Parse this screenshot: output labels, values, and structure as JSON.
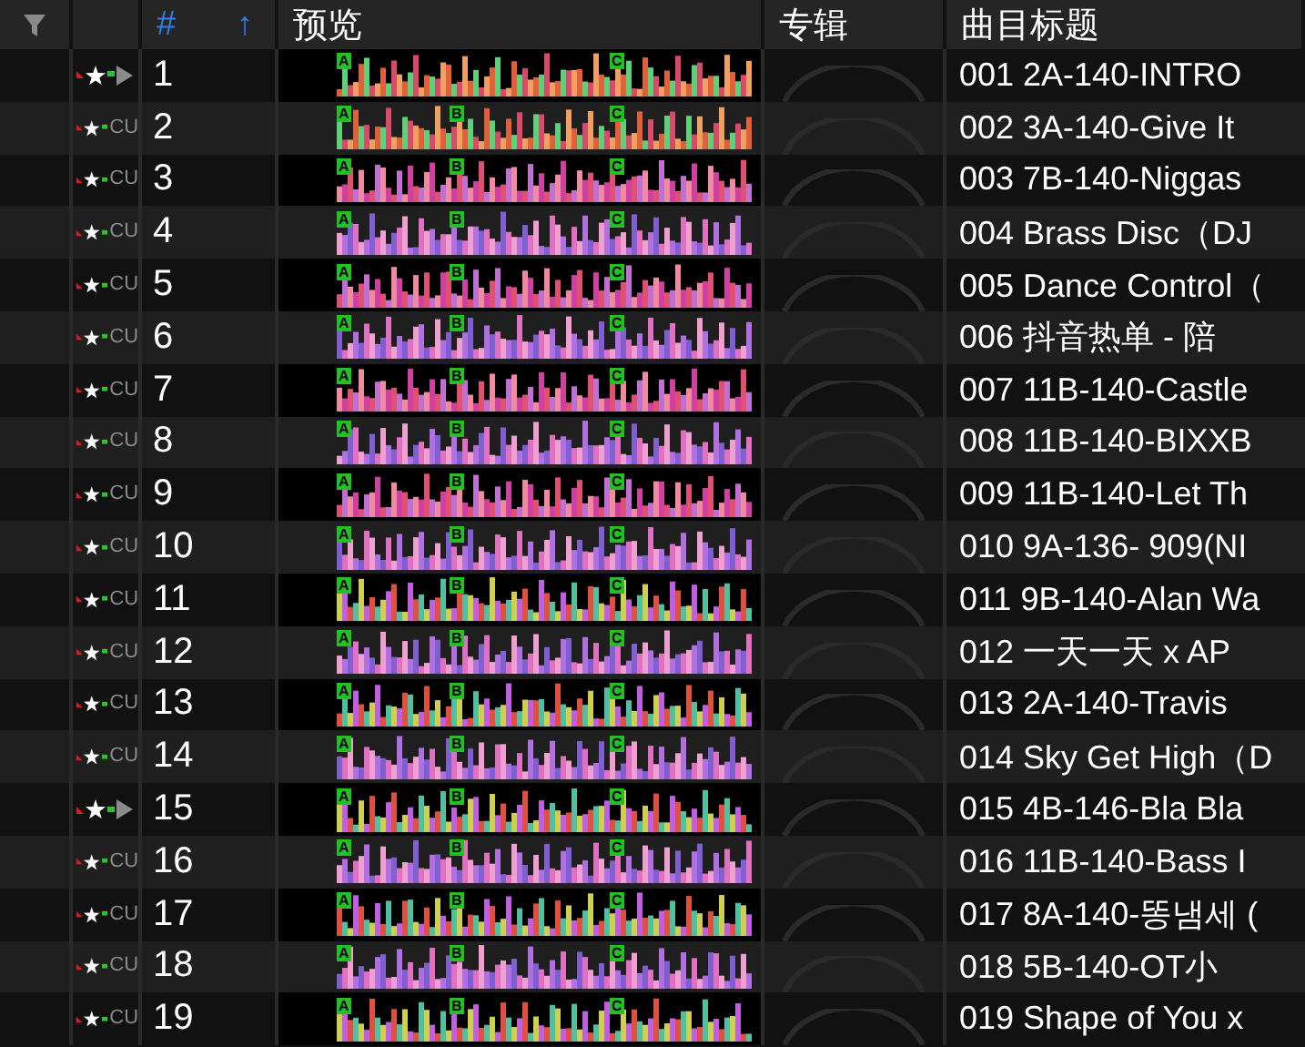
{
  "header": {
    "number": "#",
    "sort": "↑",
    "preview": "预览",
    "album": "专辑",
    "title": "曲目标题"
  },
  "rows": [
    {
      "cue": {
        "kind": "play"
      },
      "number": "1",
      "markers": [
        "A",
        "C"
      ],
      "title": "001 2A-140-INTRO"
    },
    {
      "cue": {
        "kind": "text",
        "label": "CU"
      },
      "number": "2",
      "markers": [
        "A",
        "B",
        "C"
      ],
      "title": "002 3A-140-Give It"
    },
    {
      "cue": {
        "kind": "text",
        "label": "CU"
      },
      "number": "3",
      "markers": [
        "A",
        "B",
        "C"
      ],
      "title": "003 7B-140-Niggas"
    },
    {
      "cue": {
        "kind": "text",
        "label": "CU"
      },
      "number": "4",
      "markers": [
        "A",
        "B",
        "C"
      ],
      "title": "004 Brass Disc（DJ"
    },
    {
      "cue": {
        "kind": "text",
        "label": "CU"
      },
      "number": "5",
      "markers": [
        "A",
        "B",
        "C"
      ],
      "title": "005 Dance Control（"
    },
    {
      "cue": {
        "kind": "text",
        "label": "CU"
      },
      "number": "6",
      "markers": [
        "A",
        "B",
        "C"
      ],
      "title": "006 抖音热单 - 陪"
    },
    {
      "cue": {
        "kind": "text",
        "label": "CU"
      },
      "number": "7",
      "markers": [
        "A",
        "B",
        "C"
      ],
      "title": "007 11B-140-Castle"
    },
    {
      "cue": {
        "kind": "text",
        "label": "CU"
      },
      "number": "8",
      "markers": [
        "A",
        "B",
        "C"
      ],
      "title": "008 11B-140-BIXXB"
    },
    {
      "cue": {
        "kind": "text",
        "label": "CU"
      },
      "number": "9",
      "markers": [
        "A",
        "B",
        "C"
      ],
      "title": "009 11B-140-Let Th"
    },
    {
      "cue": {
        "kind": "text",
        "label": "CU"
      },
      "number": "10",
      "markers": [
        "A",
        "B",
        "C"
      ],
      "title": "010 9A-136- 909(NI"
    },
    {
      "cue": {
        "kind": "text",
        "label": "CU"
      },
      "number": "11",
      "markers": [
        "A",
        "B",
        "C"
      ],
      "title": "011 9B-140-Alan Wa"
    },
    {
      "cue": {
        "kind": "text",
        "label": "CU"
      },
      "number": "12",
      "markers": [
        "A",
        "B",
        "C"
      ],
      "title": "012 一天一天 x AP"
    },
    {
      "cue": {
        "kind": "text",
        "label": "CU"
      },
      "number": "13",
      "markers": [
        "A",
        "B",
        "C"
      ],
      "title": "013 2A-140-Travis"
    },
    {
      "cue": {
        "kind": "text",
        "label": "CU"
      },
      "number": "14",
      "markers": [
        "A",
        "B",
        "C"
      ],
      "title": "014 Sky Get High（D"
    },
    {
      "cue": {
        "kind": "play"
      },
      "number": "15",
      "markers": [
        "A",
        "B",
        "C"
      ],
      "title": "015 4B-146-Bla Bla"
    },
    {
      "cue": {
        "kind": "text",
        "label": "CU"
      },
      "number": "16",
      "markers": [
        "A",
        "B",
        "C"
      ],
      "title": "016 11B-140-Bass I"
    },
    {
      "cue": {
        "kind": "text",
        "label": "CU"
      },
      "number": "17",
      "markers": [
        "A",
        "B",
        "C"
      ],
      "title": "017 8A-140-똥냄세 ("
    },
    {
      "cue": {
        "kind": "text",
        "label": "CU"
      },
      "number": "18",
      "markers": [
        "A",
        "B",
        "C"
      ],
      "title": "018 5B-140-OT小"
    },
    {
      "cue": {
        "kind": "text",
        "label": "CU"
      },
      "number": "19",
      "markers": [
        "A",
        "B",
        "C"
      ],
      "title": "019 Shape of You x"
    }
  ]
}
